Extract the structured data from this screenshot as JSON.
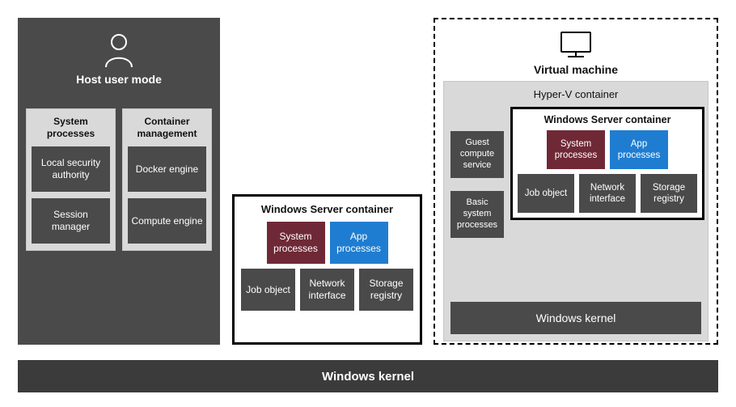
{
  "kernel": {
    "label": "Windows kernel"
  },
  "host": {
    "title": "Host user mode",
    "columns": [
      {
        "title": "System processes",
        "items": [
          "Local security authority",
          "Session manager"
        ]
      },
      {
        "title": "Container management",
        "items": [
          "Docker engine",
          "Compute engine"
        ]
      }
    ]
  },
  "wsc": {
    "title": "Windows Server container",
    "top": [
      {
        "label": "System processes",
        "color": "maroon"
      },
      {
        "label": "App processes",
        "color": "blue"
      }
    ],
    "bottom": [
      {
        "label": "Job object",
        "color": "dark"
      },
      {
        "label": "Network interface",
        "color": "dark"
      },
      {
        "label": "Storage registry",
        "color": "dark"
      }
    ]
  },
  "vm": {
    "title": "Virtual machine",
    "hyperv": {
      "title": "Hyper-V container",
      "left": [
        "Guest compute service",
        "Basic system processes"
      ],
      "wsc": {
        "title": "Windows Server container",
        "top": [
          {
            "label": "System processes",
            "color": "maroon"
          },
          {
            "label": "App processes",
            "color": "blue"
          }
        ],
        "bottom": [
          {
            "label": "Job object",
            "color": "dark"
          },
          {
            "label": "Network interface",
            "color": "dark"
          },
          {
            "label": "Storage registry",
            "color": "dark"
          }
        ]
      },
      "kernel": "Windows kernel"
    }
  }
}
